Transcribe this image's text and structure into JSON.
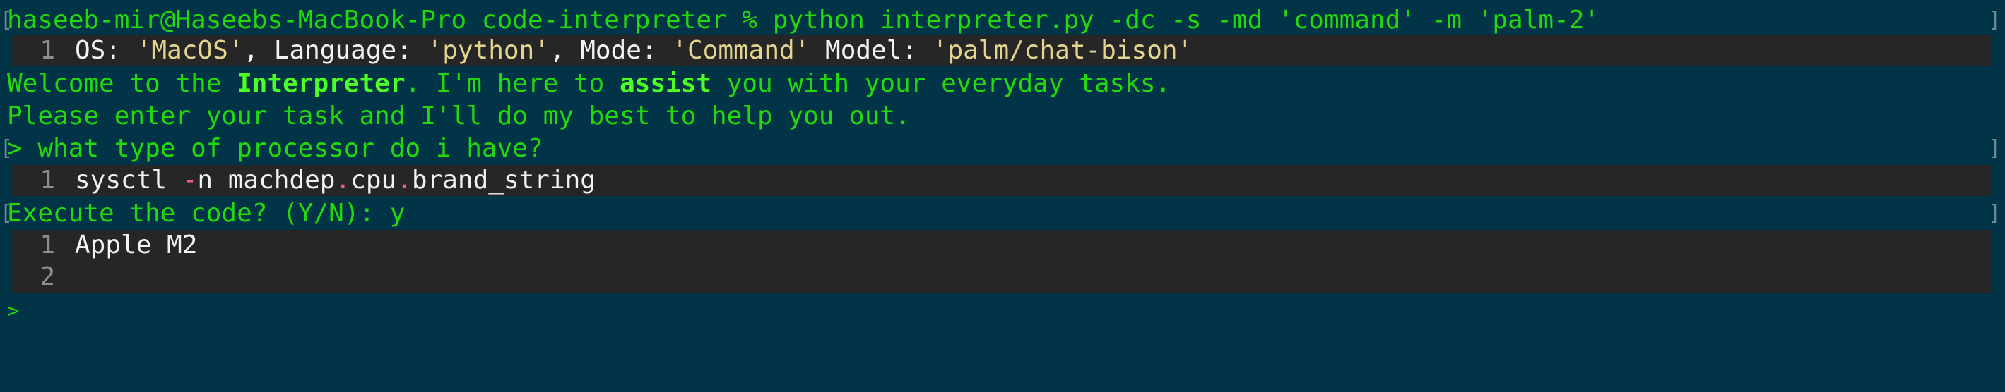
{
  "command": {
    "prompt": "haseeb-mir@Haseebs-MacBook-Pro code-interpreter % ",
    "text": "python interpreter.py -dc -s -md 'command' -m 'palm-2'"
  },
  "config": {
    "line_number": "1",
    "os_label": "OS: ",
    "os_value": "'MacOS'",
    "language_label": ", Language: ",
    "language_value": "'python'",
    "mode_label": ", Mode: ",
    "mode_value": "'Command'",
    "model_label": " Model: ",
    "model_value": "'palm/chat-bison'"
  },
  "welcome": {
    "part1": "Welcome to the ",
    "bold1": "Interpreter",
    "part2": ". I'm here to ",
    "bold2": "assist",
    "part3": " you with your everyday tasks."
  },
  "instruction": "Please enter your task and I'll do my best to help you out.",
  "user_query": "> what type of processor do i have?",
  "generated_code": {
    "line_number": "1",
    "cmd": "sysctl ",
    "flag_dash": "-",
    "flag": "n machdep",
    "dot1": ".",
    "mid": "cpu",
    "dot2": ".",
    "tail": "brand_string"
  },
  "execute_prompt": "Execute the code? (Y/N): y",
  "output": [
    {
      "line_number": "1",
      "text": "Apple M2"
    },
    {
      "line_number": "2",
      "text": ""
    }
  ],
  "final_prompt": ">",
  "colors": {
    "background": "#003446",
    "terminal_green": "#23d90e",
    "code_background": "#262626",
    "string_yellow": "#e3d58f",
    "operator_pink": "#f4607a"
  }
}
